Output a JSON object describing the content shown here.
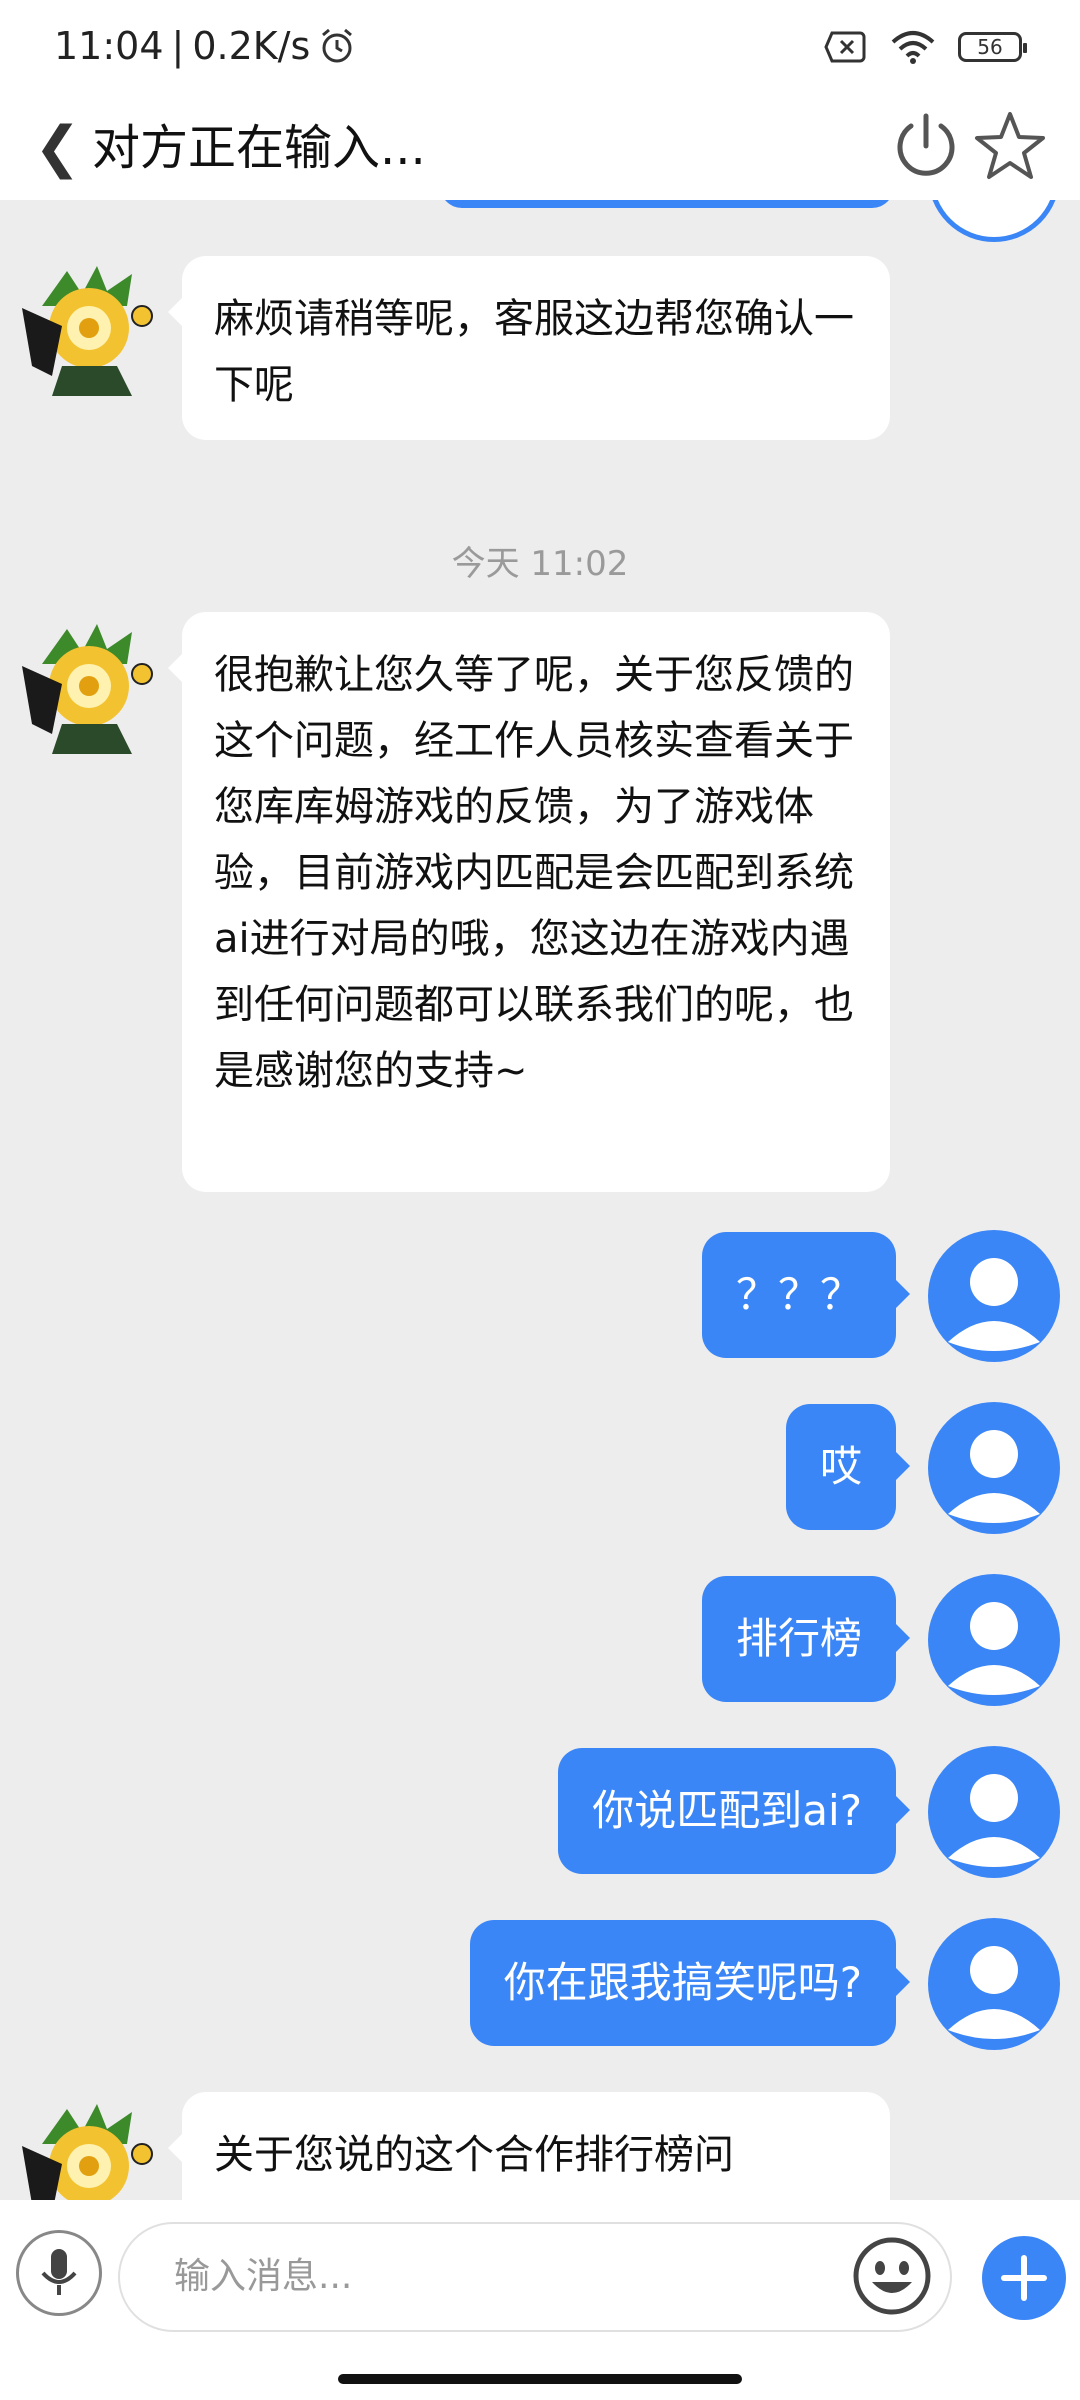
{
  "status_bar": {
    "time": "11:04",
    "separator": "|",
    "net_speed": "0.2K/s",
    "battery": "56"
  },
  "header": {
    "title": "对方正在输入..."
  },
  "chat": {
    "messages_before": [
      {
        "sender": "agent",
        "text": "麻烦请稍等呢，客服这边帮您确认一下呢"
      }
    ],
    "timestamp": "今天 11:02",
    "agent_reply": "很抱歉让您久等了呢，关于您反馈的这个问题，经工作人员核实查看关于您库库姆游戏的反馈，为了游戏体验，目前游戏内匹配是会匹配到系统ai进行对局的哦，您这边在游戏内遇到任何问题都可以联系我们的呢，也是感谢您的支持~",
    "user_messages": [
      "？？？",
      "哎",
      "排行榜",
      "你说匹配到ai?",
      "你在跟我搞笑呢吗?"
    ],
    "agent_partial": "关于您说的这个合作排行榜问"
  },
  "input": {
    "placeholder": "输入消息..."
  },
  "colors": {
    "accent": "#3b86f6",
    "bubble_in": "#ffffff",
    "background": "#ededed"
  },
  "icons": [
    "back-chevron-icon",
    "power-icon",
    "star-icon",
    "alarm-icon",
    "sim-off-icon",
    "wifi-icon",
    "battery-icon",
    "mic-icon",
    "emoji-icon",
    "plus-icon",
    "user-avatar-icon"
  ]
}
